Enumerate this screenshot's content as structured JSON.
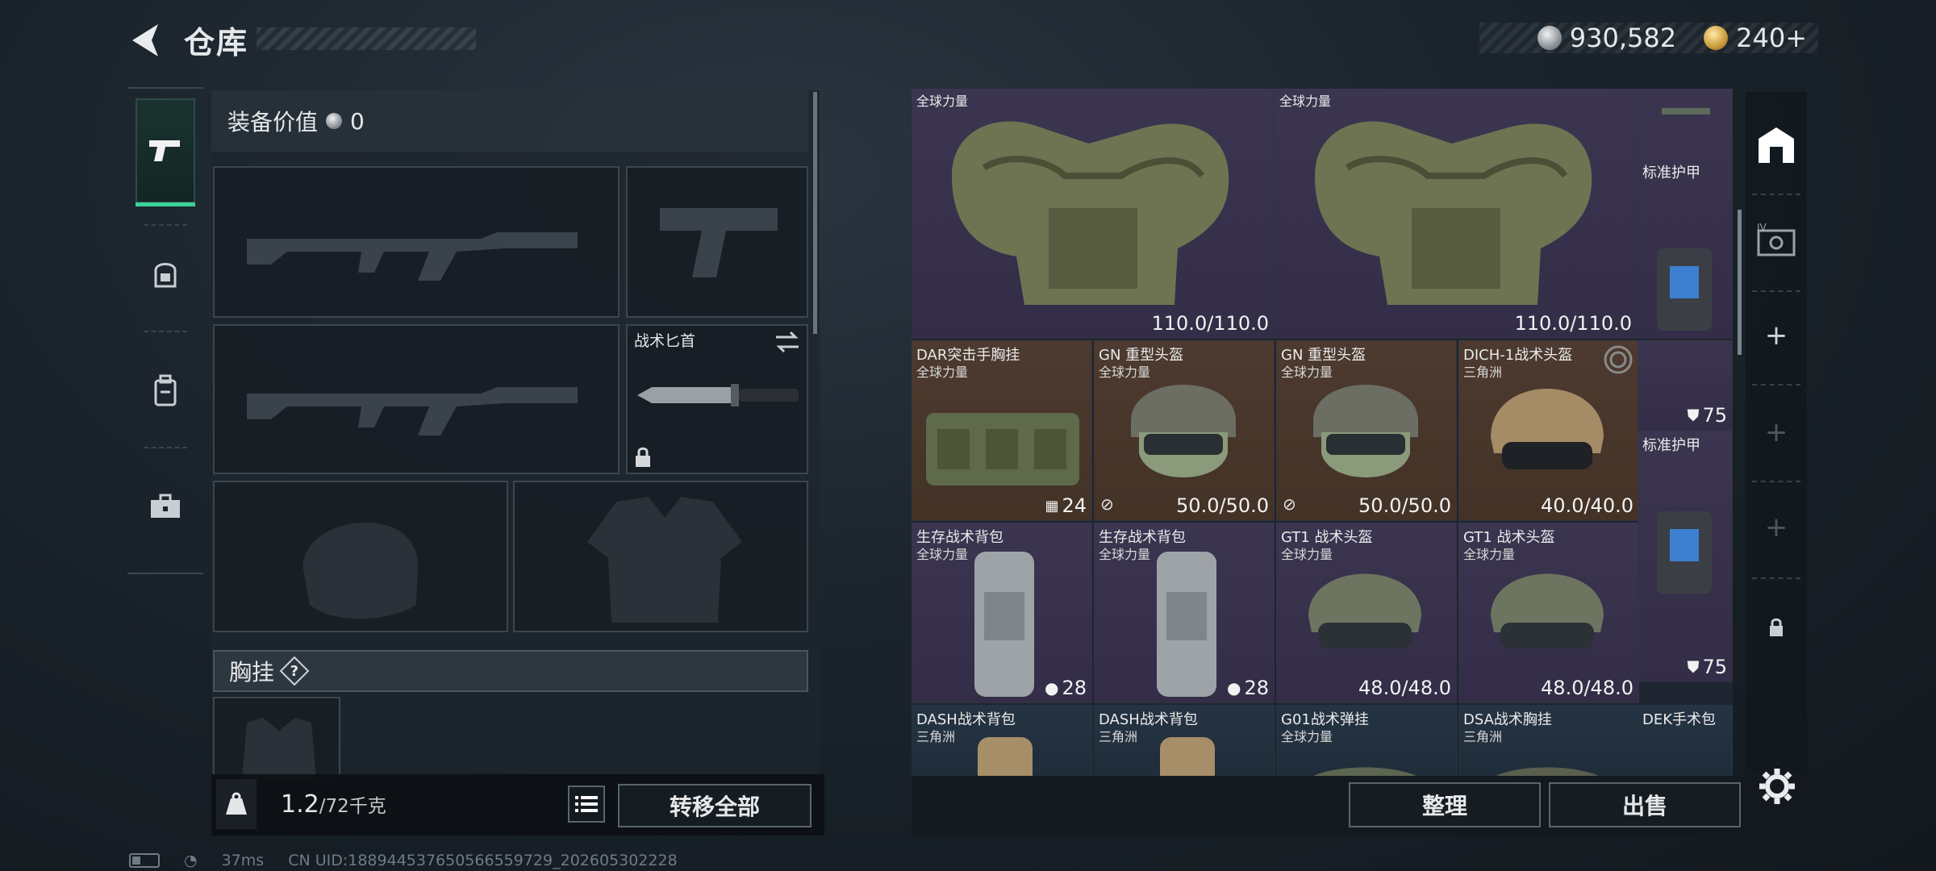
{
  "header": {
    "title": "仓库",
    "currency_primary": "930,582",
    "currency_secondary": "240+",
    "colors": {
      "accent": "#3ad29a",
      "panel": "#1f2530"
    }
  },
  "left_nav": [
    {
      "name": "weapons",
      "icon": "pistol-icon",
      "active": true
    },
    {
      "name": "gear",
      "icon": "helmet-armor-icon",
      "active": false
    },
    {
      "name": "backpack",
      "icon": "backpack-icon",
      "active": false
    },
    {
      "name": "kit",
      "icon": "briefcase-icon",
      "active": false
    }
  ],
  "loadout": {
    "equipment_value_label": "装备价值",
    "equipment_value": "0",
    "melee_label": "战术匕首",
    "chest_rig_label": "胸挂",
    "chest_rig_help": "?",
    "weight_current": "1.2",
    "weight_max": "/72千克",
    "transfer_all": "转移全部"
  },
  "storage": {
    "items": [
      {
        "name": "",
        "origin": "全球力量",
        "durability": "110.0/110.0"
      },
      {
        "name": "",
        "origin": "全球力量",
        "durability": "110.0/110.0"
      },
      {
        "name": "标准护甲",
        "origin": "",
        "value": "75"
      },
      {
        "name": "DAR突击手胸挂",
        "origin": "全球力量",
        "value": "24"
      },
      {
        "name": "GN 重型头盔",
        "origin": "全球力量",
        "durability": "50.0/50.0"
      },
      {
        "name": "GN 重型头盔",
        "origin": "全球力量",
        "durability": "50.0/50.0"
      },
      {
        "name": "DICH-1战术头盔",
        "origin": "三角洲",
        "durability": "40.0/40.0"
      },
      {
        "name": "标准护甲",
        "origin": "",
        "value": "75"
      },
      {
        "name": "生存战术背包",
        "origin": "全球力量",
        "value": "28"
      },
      {
        "name": "生存战术背包",
        "origin": "全球力量",
        "value": "28"
      },
      {
        "name": "GT1 战术头盔",
        "origin": "全球力量",
        "durability": "48.0/48.0"
      },
      {
        "name": "GT1 战术头盔",
        "origin": "全球力量",
        "durability": "48.0/48.0"
      },
      {
        "name": "DASH战术背包",
        "origin": "三角洲"
      },
      {
        "name": "DASH战术背包",
        "origin": "三角洲"
      },
      {
        "name": "G01战术弹挂",
        "origin": "全球力量"
      },
      {
        "name": "DSA战术胸挂",
        "origin": "三角洲"
      },
      {
        "name": "DEK手术包",
        "origin": ""
      }
    ],
    "sort_button": "整理",
    "sell_button": "出售"
  },
  "status_bar": {
    "ping": "37ms",
    "uid": "CN UID:18894453765056655972​9_202605302228"
  }
}
